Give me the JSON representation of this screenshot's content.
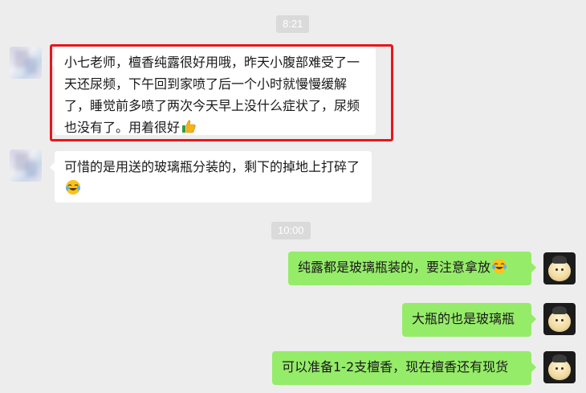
{
  "timestamps": [
    "8:21",
    "10:00"
  ],
  "messages": [
    {
      "direction": "in",
      "text": "小七老师，檀香纯露很好用哦，昨天小腹部难受了一天还尿频，下午回到家喷了后一个小时就慢慢缓解了，睡觉前多喷了两次今天早上没什么症状了，尿频也没有了。用着很好",
      "emoji": "thumbs-up",
      "highlighted": true
    },
    {
      "direction": "in",
      "text": "可惜的是用送的玻璃瓶分装的，剩下的掉地上打碎了",
      "emoji": "laughing-crying",
      "highlighted": false
    },
    {
      "direction": "out",
      "text": "纯露都是玻璃瓶装的，要注意拿放",
      "emoji": "laughing-crying"
    },
    {
      "direction": "out",
      "text": "大瓶的也是玻璃瓶",
      "emoji": ""
    },
    {
      "direction": "out",
      "text": "可以准备1-2支檀香，现在檀香还有现货",
      "emoji": ""
    }
  ],
  "colors": {
    "background": "#ededed",
    "incoming_bubble": "#ffffff",
    "outgoing_bubble": "#95ec69",
    "highlight_border": "#e8161b",
    "timestamp_pill": "#dadada"
  }
}
